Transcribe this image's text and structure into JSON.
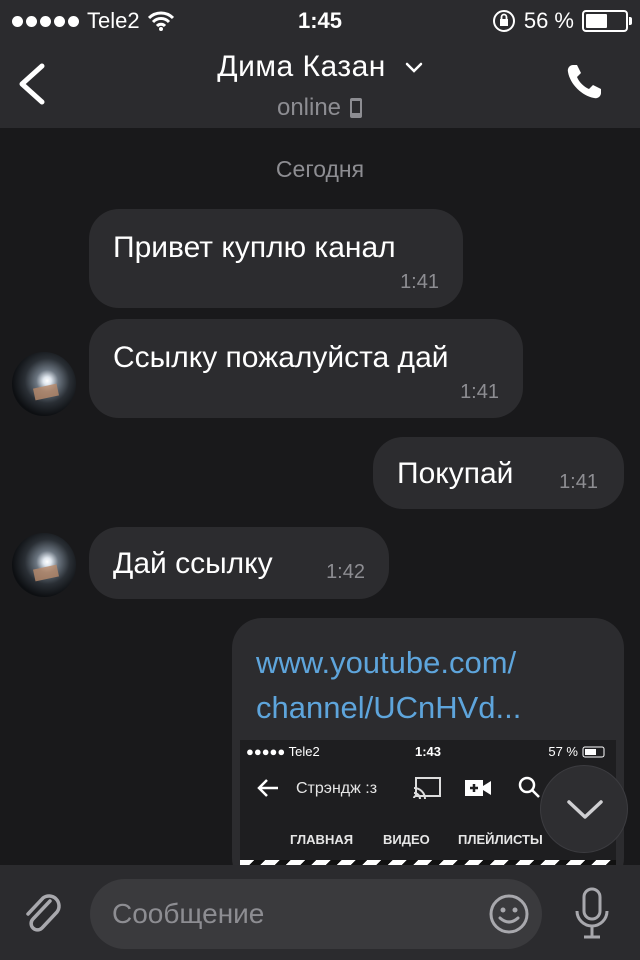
{
  "status_bar": {
    "carrier": "Tele2",
    "time": "1:45",
    "battery_text": "56 %",
    "battery_level": 0.56
  },
  "header": {
    "title": "Дима Казан",
    "status": "online"
  },
  "chat": {
    "date_label": "Сегодня",
    "messages": [
      {
        "text": "Привет куплю канал",
        "time": "1:41",
        "direction": "incoming"
      },
      {
        "text": "Ссылку пожалуйста дай",
        "time": "1:41",
        "direction": "incoming"
      },
      {
        "text": "Покупай",
        "time": "1:41",
        "direction": "outgoing"
      },
      {
        "text": "Дай ссылку",
        "time": "1:42",
        "direction": "incoming"
      }
    ],
    "link_message": {
      "line1": "www.youtube.com/",
      "line2": "channel/UCnHVd...",
      "preview": {
        "carrier": "Tele2",
        "time": "1:43",
        "battery_text": "57 %",
        "channel_title": "Стрэндж :з",
        "tabs": [
          "ГЛАВНАЯ",
          "ВИДЕО",
          "ПЛЕЙЛИСТЫ"
        ]
      }
    }
  },
  "input": {
    "placeholder": "Сообщение"
  },
  "icons": {
    "back": "chevron-left-icon",
    "call": "phone-icon",
    "attach": "paperclip-icon",
    "emoji": "smiley-icon",
    "mic": "microphone-icon",
    "scroll": "chevron-down-icon"
  },
  "colors": {
    "background": "#19191b",
    "bar": "#2b2b2e",
    "bubble": "#2c2c2f",
    "link": "#5ea5dc",
    "secondary_text": "#8d8d92"
  }
}
